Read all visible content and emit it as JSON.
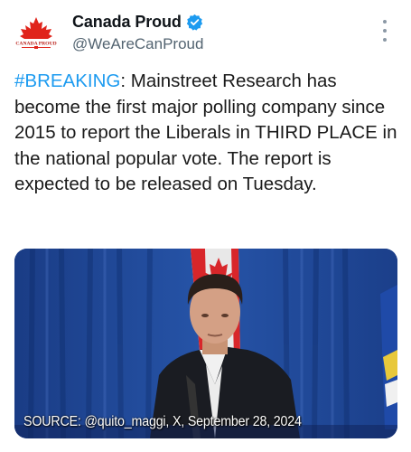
{
  "tweet": {
    "author": {
      "display_name": "Canada Proud",
      "handle": "@WeAreCanProud",
      "verified": true,
      "avatar_text": "CANADA PROUD"
    },
    "more_icon": "more-vertical-icon",
    "text_hashtag": "#BREAKING",
    "text_body": ": Mainstreet Research has become the first major polling company since 2015 to report the Liberals in THIRD PLACE in the national popular vote. The report is expected to be released on Tuesday.",
    "media": {
      "caption": "SOURCE: @quito_maggi, X, September 28, 2024"
    }
  },
  "colors": {
    "hashtag": "#1d9bf0",
    "verified": "#1d9bf0",
    "handle": "#536471",
    "maple_red": "#e0241b"
  }
}
